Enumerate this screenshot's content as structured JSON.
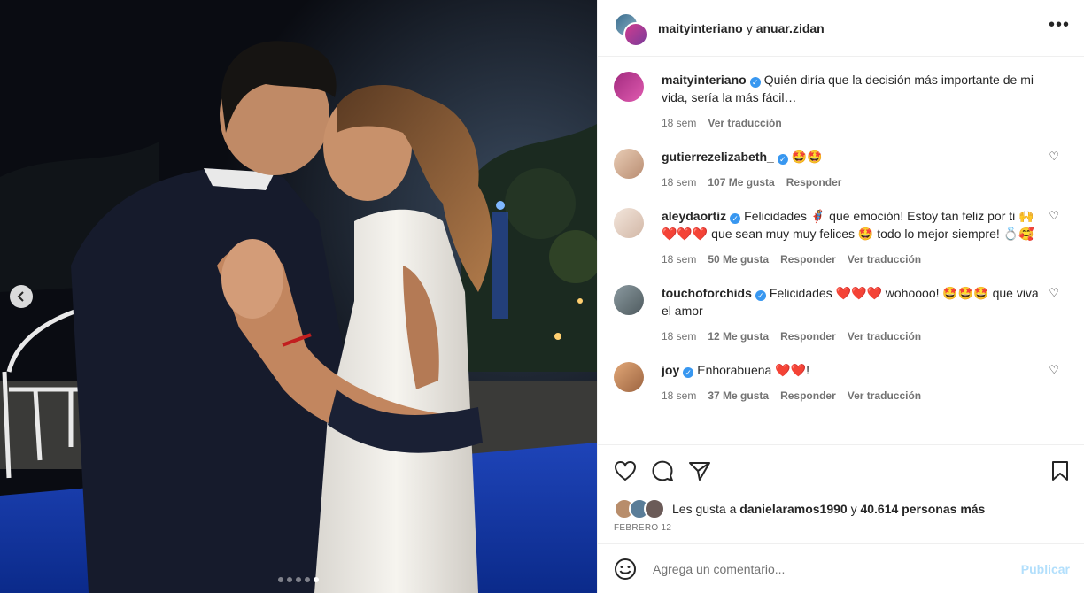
{
  "post": {
    "header": {
      "user1": "maityinteriano",
      "connector": "y",
      "user2": "anuar.zidan"
    },
    "carousel": {
      "slides": 5,
      "active": 5
    }
  },
  "comments": [
    {
      "user": "maityinteriano",
      "verified": true,
      "text": "Quién diría que la decisión más importante de mi vida, sería la más fácil…",
      "time": "18 sem",
      "likes": "",
      "reply": "",
      "translate": "Ver traducción",
      "avatar_color": "#9a2f7e",
      "is_caption": true
    },
    {
      "user": "gutierrezelizabeth_",
      "verified": true,
      "text": "🤩🤩",
      "time": "18 sem",
      "likes": "107 Me gusta",
      "reply": "Responder",
      "translate": "",
      "avatar_color": "#d9b79a"
    },
    {
      "user": "aleydaortiz",
      "verified": true,
      "text": "Felicidades 🦸 que emoción! Estoy tan feliz por ti 🙌❤️❤️❤️ que sean muy muy felices 🤩 todo lo mejor siempre! 💍🥰",
      "time": "18 sem",
      "likes": "50 Me gusta",
      "reply": "Responder",
      "translate": "Ver traducción",
      "avatar_color": "#e8d2c4"
    },
    {
      "user": "touchoforchids",
      "verified": true,
      "text": "Felicidades ❤️❤️❤️ wohoooo! 🤩🤩🤩 que viva el amor",
      "time": "18 sem",
      "likes": "12 Me gusta",
      "reply": "Responder",
      "translate": "Ver traducción",
      "avatar_color": "#6f7f86"
    },
    {
      "user": "joy",
      "verified": true,
      "text": "Enhorabuena ❤️❤️!",
      "time": "18 sem",
      "likes": "37 Me gusta",
      "reply": "Responder",
      "translate": "Ver traducción",
      "avatar_color": "#c98f5f"
    }
  ],
  "likes": {
    "prefix": "Les gusta a",
    "user": "danielaramos1990",
    "connector": "y",
    "others": "40.614 personas más"
  },
  "date": "FEBRERO 12",
  "add_comment": {
    "placeholder": "Agrega un comentario...",
    "publish": "Publicar"
  }
}
